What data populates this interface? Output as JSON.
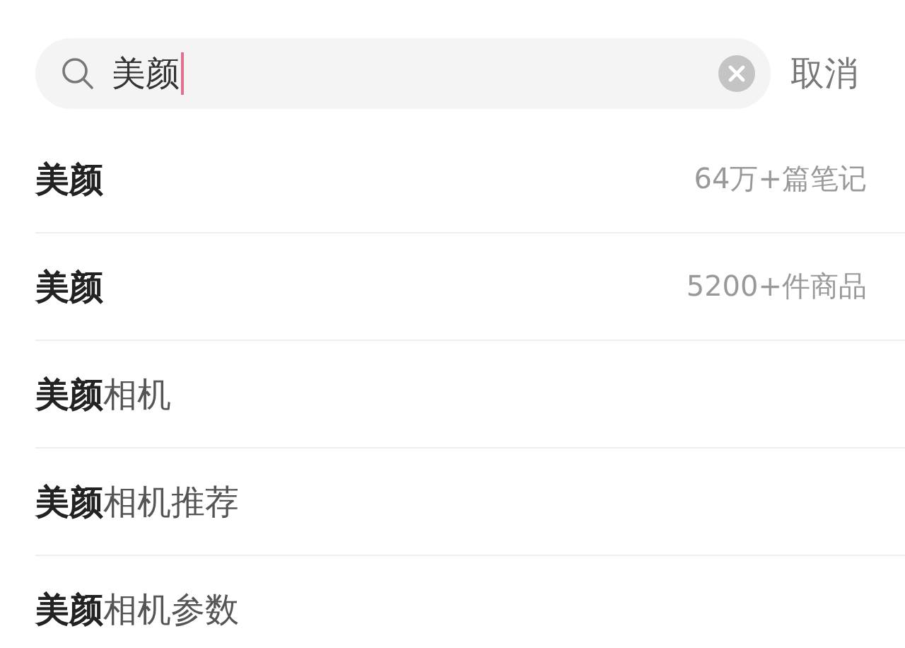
{
  "search": {
    "value": "美颜",
    "cancel": "取消"
  },
  "suggestions": [
    {
      "text": "美颜",
      "count": "64万+篇笔记"
    },
    {
      "text": "美颜",
      "count": "5200+件商品"
    },
    {
      "text": "**美颜**相机"
    },
    {
      "text": "**美颜**相机推荐"
    },
    {
      "text": "**美颜**相机参数"
    }
  ]
}
